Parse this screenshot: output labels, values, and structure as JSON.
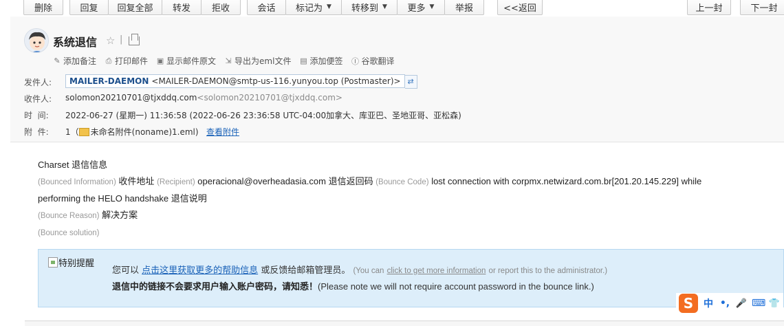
{
  "toolbar": {
    "buttons": [
      "删除",
      "回复",
      "回复全部",
      "转发",
      "拒收",
      "会话",
      "标记为",
      "转移到",
      "更多",
      "举报",
      "<<返回",
      "上一封",
      "下一封"
    ]
  },
  "header": {
    "subject": "系统退信",
    "actions": [
      {
        "icon": "pencil-icon",
        "label": "添加备注"
      },
      {
        "icon": "printer-icon",
        "label": "打印邮件"
      },
      {
        "icon": "source-icon",
        "label": "显示邮件原文"
      },
      {
        "icon": "export-icon",
        "label": "导出为eml文件"
      },
      {
        "icon": "note-icon",
        "label": "添加便签"
      },
      {
        "icon": "translate-icon",
        "label": "谷歌翻译"
      }
    ],
    "from_label": "发件人:",
    "from_name": "MAILER-DAEMON",
    "from_address": "<MAILER-DAEMON@smtp-us-116.yunyou.top (Postmaster)>",
    "to_label": "收件人:",
    "to_name": "solomon20210701@tjxddq.com",
    "to_address": "<solomon20210701@tjxddq.com>",
    "time_label": "时  间:",
    "time_value": "2022-06-27 (星期一) 11:36:58 (2022-06-26 23:36:58 UTC-04:00加拿大、库亚巴、圣地亚哥、亚松森)",
    "attach_label": "附  件:",
    "attach_count": "1",
    "attach_name": "未命名附件(noname)1.eml)",
    "attach_link": "查看附件"
  },
  "body": {
    "line1": "Charset 退信信息",
    "bounced_info_en": "(Bounced Information)",
    "recipient_cn": "收件地址",
    "recipient_en": "(Recipient)",
    "recipient_value": "operacional@overheadasia.com",
    "bounce_code_cn": "退信返回码",
    "bounce_code_en": "(Bounce Code)",
    "bounce_code_value": "lost connection with corpmx.netwizard.com.br[201.20.145.229] while",
    "line3": "performing the HELO handshake",
    "reason_cn": "退信说明",
    "reason_en": "(Bounce Reason)",
    "solution_cn": "解决方案",
    "solution_en": "(Bounce solution)"
  },
  "notice": {
    "img_alt": "特别提醒",
    "line1_prefix": "您可以",
    "line1_link": "点击这里获取更多的帮助信息",
    "line1_suffix": "或反馈给邮箱管理员。",
    "line1_en_prefix": "(You can",
    "line1_en_link": "click to get more information",
    "line1_en_suffix": "or report this to the administrator.)",
    "line2_bold": "退信中的链接不会要求用户输入账户密码，请知悉！",
    "line2_en": "(Please note we will not require account password in the bounce link.)"
  },
  "ime": {
    "logo": "S",
    "mode": "中",
    "punct": "•,",
    "mic": "🎤",
    "keyboard": "⌨",
    "skin": "👕"
  },
  "colors": {
    "link": "#1a62b8",
    "notice_bg": "#ddeefa",
    "ime_orange": "#f36d21"
  }
}
